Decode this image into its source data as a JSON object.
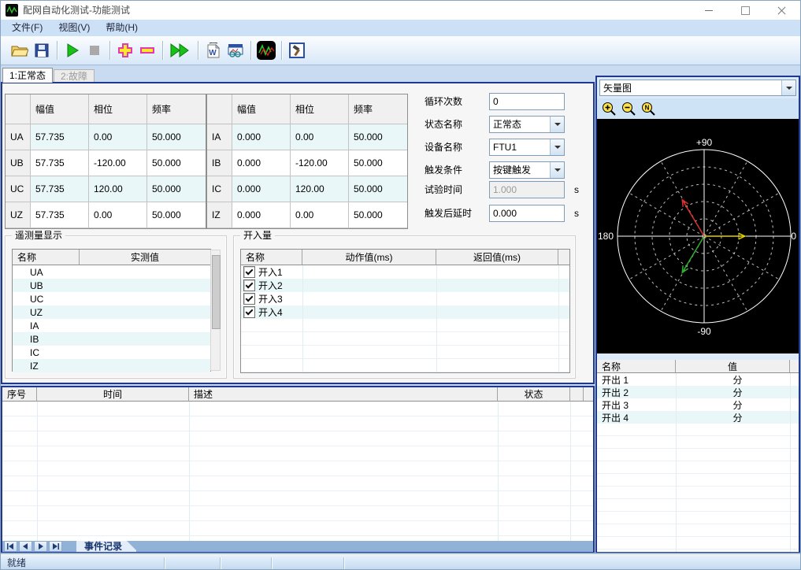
{
  "window": {
    "title": "配网自动化测试-功能测试"
  },
  "menu": {
    "items": [
      "文件(F)",
      "视图(V)",
      "帮助(H)"
    ]
  },
  "toolbar": {
    "icons": [
      "open-file",
      "save",
      "start-test",
      "stop-test",
      "add",
      "remove",
      "fast-run",
      "word-report",
      "report-preview",
      "waveform-view",
      "tool-settings"
    ]
  },
  "tabs": [
    {
      "label": "1:正常态"
    },
    {
      "label": "2:故障"
    }
  ],
  "voltage_table": {
    "headers": [
      "幅值",
      "相位",
      "频率"
    ],
    "rows": [
      [
        "UA",
        "57.735",
        "0.00",
        "50.000"
      ],
      [
        "UB",
        "57.735",
        "-120.00",
        "50.000"
      ],
      [
        "UC",
        "57.735",
        "120.00",
        "50.000"
      ],
      [
        "UZ",
        "57.735",
        "0.00",
        "50.000"
      ]
    ]
  },
  "current_table": {
    "headers": [
      "幅值",
      "相位",
      "频率"
    ],
    "rows": [
      [
        "IA",
        "0.000",
        "0.00",
        "50.000"
      ],
      [
        "IB",
        "0.000",
        "-120.00",
        "50.000"
      ],
      [
        "IC",
        "0.000",
        "120.00",
        "50.000"
      ],
      [
        "IZ",
        "0.000",
        "0.00",
        "50.000"
      ]
    ]
  },
  "settings": {
    "fields": [
      {
        "label": "循环次数",
        "value": "0"
      },
      {
        "label": "状态名称",
        "value": "正常态"
      },
      {
        "label": "设备名称",
        "value": "FTU1"
      },
      {
        "label": "触发条件",
        "value": "按键触发"
      },
      {
        "label": "试验时间",
        "value": "1.000",
        "suffix": "s"
      },
      {
        "label": "触发后延时",
        "value": "0.000",
        "suffix": "s"
      }
    ]
  },
  "telemetry": {
    "title": "遥测量显示",
    "headers": [
      "名称",
      "实测值"
    ],
    "rows": [
      "UA",
      "UB",
      "UC",
      "UZ",
      "IA",
      "IB",
      "IC",
      "IZ"
    ]
  },
  "digital_inputs": {
    "title": "开入量",
    "headers": [
      "名称",
      "动作值(ms)",
      "返回值(ms)"
    ],
    "rows": [
      {
        "label": "开入1",
        "checked": true
      },
      {
        "label": "开入2",
        "checked": true
      },
      {
        "label": "开入3",
        "checked": true
      },
      {
        "label": "开入4",
        "checked": true
      }
    ]
  },
  "events": {
    "headers": [
      "序号",
      "时间",
      "描述",
      "状态"
    ],
    "tab": "事件记录"
  },
  "vector_panel": {
    "selector": "矢量图",
    "zoom_icons": [
      "zoom-in",
      "zoom-out",
      "zoom-reset"
    ],
    "output_table": {
      "headers": [
        "名称",
        "值"
      ],
      "rows": [
        [
          "开出 1",
          "分"
        ],
        [
          "开出 2",
          "分"
        ],
        [
          "开出 3",
          "分"
        ],
        [
          "开出 4",
          "分"
        ]
      ]
    }
  },
  "chart_data": {
    "type": "polar_phasor",
    "axis_labels": {
      "top": "+90",
      "left": "180",
      "right": "0",
      "bottom": "-90"
    },
    "rings": 5,
    "radial_step_deg": 30,
    "vectors": [
      {
        "name": "phase-a-yellow",
        "color": "#e3cf00",
        "angle_deg": 0,
        "magnitude_ratio": 0.47
      },
      {
        "name": "phase-c-red",
        "color": "#d83028",
        "angle_deg": 121,
        "magnitude_ratio": 0.49
      },
      {
        "name": "phase-b-green",
        "color": "#2fae2f",
        "angle_deg": -121,
        "magnitude_ratio": 0.49
      }
    ]
  },
  "status_bar": {
    "text": "就绪"
  }
}
